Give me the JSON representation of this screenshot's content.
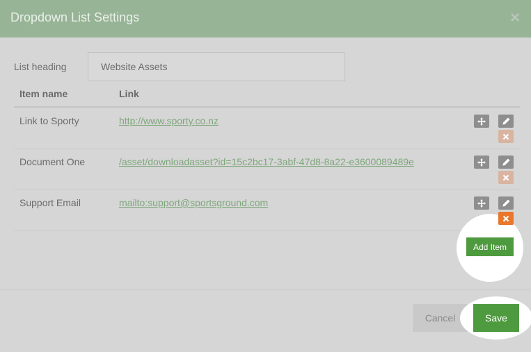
{
  "dialog": {
    "title": "Dropdown List Settings",
    "close_icon": "close-icon"
  },
  "form": {
    "heading_label": "List heading",
    "heading_value": "Website Assets"
  },
  "table": {
    "columns": [
      "Item name",
      "Link"
    ],
    "rows": [
      {
        "name": "Link to Sporty",
        "link": "http://www.sporty.co.nz"
      },
      {
        "name": "Document One",
        "link": "/asset/downloadasset?id=15c2bc17-3abf-47d8-8a22-e3600089489e"
      },
      {
        "name": "Support Email",
        "link": "mailto:support@sportsground.com"
      }
    ],
    "row_icons": [
      "move-icon",
      "pencil-icon",
      "delete-icon"
    ]
  },
  "actions": {
    "add_item": "Add Item",
    "cancel": "Cancel",
    "save": "Save"
  },
  "colors": {
    "header": "#98b497",
    "primary": "#4e9a3e",
    "delete_active": "#e9772c",
    "link": "#7fa77c"
  }
}
